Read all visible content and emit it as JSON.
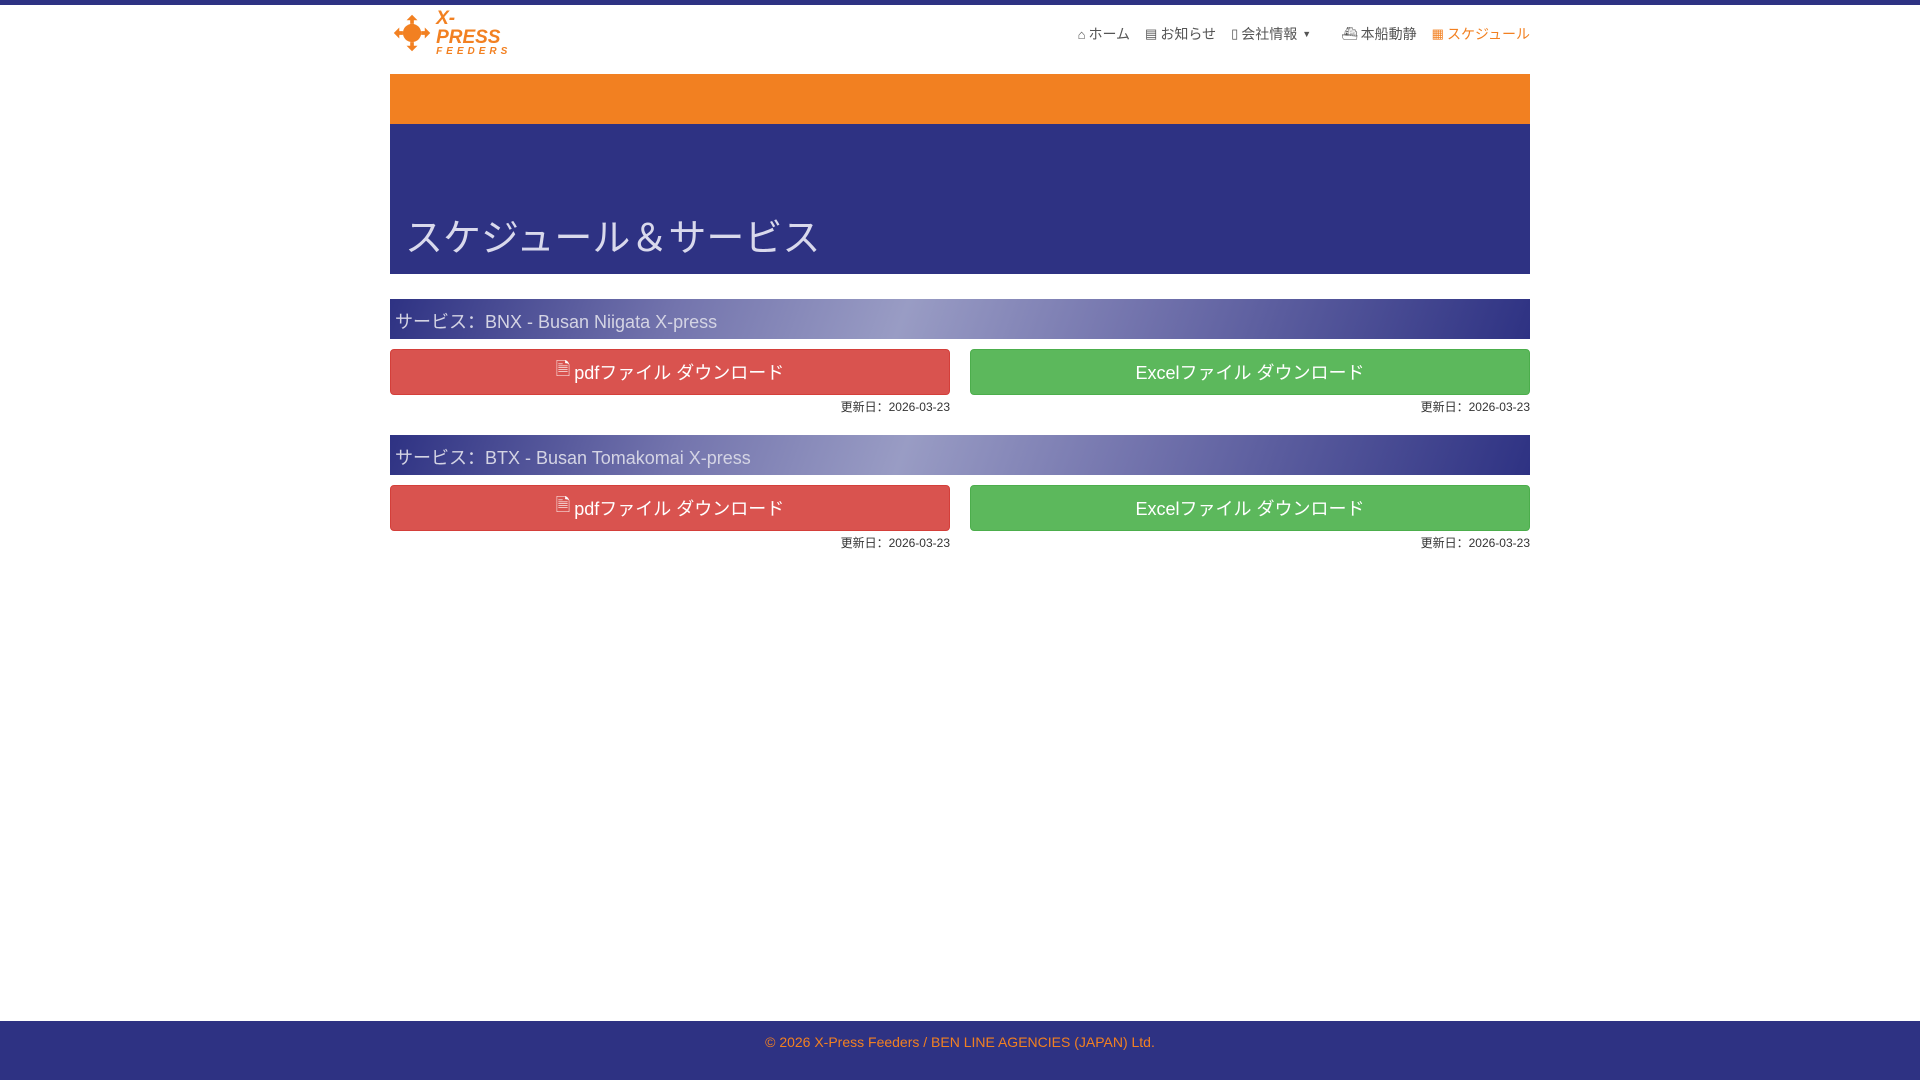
{
  "brand": {
    "line1": "X-PRESS",
    "line2": "FEEDERS"
  },
  "nav": [
    {
      "label": "ホーム",
      "icon": "home-icon"
    },
    {
      "label": "お知らせ",
      "icon": "newspaper-icon"
    },
    {
      "label": "会社情報",
      "icon": "building-icon"
    },
    {
      "label": "本船動静",
      "icon": "ship-icon"
    },
    {
      "label": "スケジュール",
      "icon": "calendar-icon"
    }
  ],
  "hero": {
    "title": "スケジュール＆サービス"
  },
  "services": [
    {
      "title": "サービス：BNX - Busan Niigata X-press",
      "pdf": "pdfファイル ダウンロード",
      "excel": "Excelファイル ダウンロード",
      "pdf_date": "更新日：2026-03-23",
      "excel_date": "更新日：2026-03-23"
    },
    {
      "title": "サービス：BTX - Busan Tomakomai X-press",
      "pdf": "pdfファイル ダウンロード",
      "excel": "Excelファイル ダウンロード",
      "pdf_date": "更新日：2026-03-23",
      "excel_date": "更新日：2026-03-23"
    }
  ],
  "footer": "© 2026 X-Press Feeders / BEN LINE AGENCIES (JAPAN) Ltd.",
  "colors": {
    "navy": "#2e3283",
    "orange": "#f28021",
    "red": "#d9534f",
    "green": "#5cb85c"
  }
}
